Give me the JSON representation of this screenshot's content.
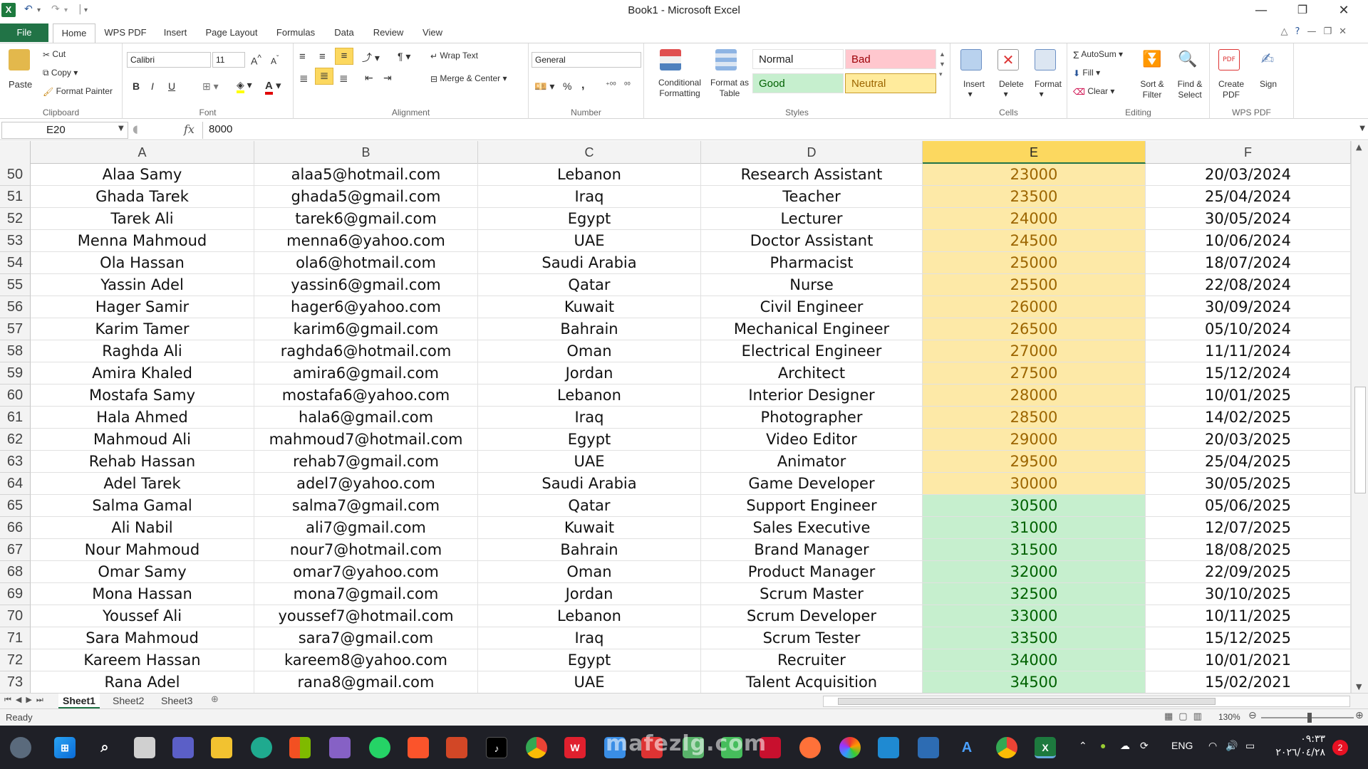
{
  "window": {
    "title": "Book1  -  Microsoft Excel",
    "controls": {
      "minimize": "—",
      "restore": "❐",
      "close": "✕"
    }
  },
  "ribbon_tabs": [
    "File",
    "Home",
    "WPS PDF",
    "Insert",
    "Page Layout",
    "Formulas",
    "Data",
    "Review",
    "View"
  ],
  "active_tab": "Home",
  "ribbon": {
    "clipboard": {
      "paste": "Paste",
      "cut": "Cut",
      "copy": "Copy",
      "format_painter": "Format Painter",
      "label": "Clipboard"
    },
    "font": {
      "name": "Calibri",
      "size": "11",
      "label": "Font",
      "bold": "B",
      "italic": "I",
      "underline": "U"
    },
    "alignment": {
      "wrap_text": "Wrap Text",
      "merge_center": "Merge & Center",
      "label": "Alignment"
    },
    "number": {
      "format": "General",
      "percent": "%",
      "comma": ",",
      "label": "Number"
    },
    "styles": {
      "conditional_formatting": "Conditional Formatting",
      "format_as_table": "Format as Table",
      "normal": "Normal",
      "bad": "Bad",
      "good": "Good",
      "neutral": "Neutral",
      "label": "Styles"
    },
    "cells": {
      "insert": "Insert",
      "delete": "Delete",
      "format": "Format",
      "label": "Cells"
    },
    "editing": {
      "autosum": "AutoSum",
      "fill": "Fill",
      "clear": "Clear",
      "sort_filter": "Sort & Filter",
      "find_select": "Find & Select",
      "label": "Editing"
    },
    "wps_pdf": {
      "create_pdf": "Create PDF",
      "sign": "Sign",
      "label": "WPS PDF"
    }
  },
  "formula_bar": {
    "name_box": "E20",
    "fx": "fx",
    "value": "8000"
  },
  "columns": [
    "A",
    "B",
    "C",
    "D",
    "E",
    "F"
  ],
  "selected_column": "E",
  "rows": [
    {
      "num": "50",
      "name": "Alaa Samy",
      "email": "alaa5@hotmail.com",
      "country": "Lebanon",
      "job": "Research Assistant",
      "salary": "23000",
      "date": "20/03/2024",
      "style": "neutral"
    },
    {
      "num": "51",
      "name": "Ghada Tarek",
      "email": "ghada5@gmail.com",
      "country": "Iraq",
      "job": "Teacher",
      "salary": "23500",
      "date": "25/04/2024",
      "style": "neutral"
    },
    {
      "num": "52",
      "name": "Tarek Ali",
      "email": "tarek6@gmail.com",
      "country": "Egypt",
      "job": "Lecturer",
      "salary": "24000",
      "date": "30/05/2024",
      "style": "neutral"
    },
    {
      "num": "53",
      "name": "Menna Mahmoud",
      "email": "menna6@yahoo.com",
      "country": "UAE",
      "job": "Doctor Assistant",
      "salary": "24500",
      "date": "10/06/2024",
      "style": "neutral"
    },
    {
      "num": "54",
      "name": "Ola Hassan",
      "email": "ola6@hotmail.com",
      "country": "Saudi Arabia",
      "job": "Pharmacist",
      "salary": "25000",
      "date": "18/07/2024",
      "style": "neutral"
    },
    {
      "num": "55",
      "name": "Yassin Adel",
      "email": "yassin6@gmail.com",
      "country": "Qatar",
      "job": "Nurse",
      "salary": "25500",
      "date": "22/08/2024",
      "style": "neutral"
    },
    {
      "num": "56",
      "name": "Hager Samir",
      "email": "hager6@yahoo.com",
      "country": "Kuwait",
      "job": "Civil Engineer",
      "salary": "26000",
      "date": "30/09/2024",
      "style": "neutral"
    },
    {
      "num": "57",
      "name": "Karim Tamer",
      "email": "karim6@gmail.com",
      "country": "Bahrain",
      "job": "Mechanical Engineer",
      "salary": "26500",
      "date": "05/10/2024",
      "style": "neutral"
    },
    {
      "num": "58",
      "name": "Raghda Ali",
      "email": "raghda6@hotmail.com",
      "country": "Oman",
      "job": "Electrical Engineer",
      "salary": "27000",
      "date": "11/11/2024",
      "style": "neutral"
    },
    {
      "num": "59",
      "name": "Amira Khaled",
      "email": "amira6@gmail.com",
      "country": "Jordan",
      "job": "Architect",
      "salary": "27500",
      "date": "15/12/2024",
      "style": "neutral"
    },
    {
      "num": "60",
      "name": "Mostafa Samy",
      "email": "mostafa6@yahoo.com",
      "country": "Lebanon",
      "job": "Interior Designer",
      "salary": "28000",
      "date": "10/01/2025",
      "style": "neutral"
    },
    {
      "num": "61",
      "name": "Hala Ahmed",
      "email": "hala6@gmail.com",
      "country": "Iraq",
      "job": "Photographer",
      "salary": "28500",
      "date": "14/02/2025",
      "style": "neutral"
    },
    {
      "num": "62",
      "name": "Mahmoud Ali",
      "email": "mahmoud7@hotmail.com",
      "country": "Egypt",
      "job": "Video Editor",
      "salary": "29000",
      "date": "20/03/2025",
      "style": "neutral"
    },
    {
      "num": "63",
      "name": "Rehab Hassan",
      "email": "rehab7@gmail.com",
      "country": "UAE",
      "job": "Animator",
      "salary": "29500",
      "date": "25/04/2025",
      "style": "neutral"
    },
    {
      "num": "64",
      "name": "Adel Tarek",
      "email": "adel7@yahoo.com",
      "country": "Saudi Arabia",
      "job": "Game Developer",
      "salary": "30000",
      "date": "30/05/2025",
      "style": "neutral"
    },
    {
      "num": "65",
      "name": "Salma Gamal",
      "email": "salma7@gmail.com",
      "country": "Qatar",
      "job": "Support Engineer",
      "salary": "30500",
      "date": "05/06/2025",
      "style": "good"
    },
    {
      "num": "66",
      "name": "Ali Nabil",
      "email": "ali7@gmail.com",
      "country": "Kuwait",
      "job": "Sales Executive",
      "salary": "31000",
      "date": "12/07/2025",
      "style": "good"
    },
    {
      "num": "67",
      "name": "Nour Mahmoud",
      "email": "nour7@hotmail.com",
      "country": "Bahrain",
      "job": "Brand Manager",
      "salary": "31500",
      "date": "18/08/2025",
      "style": "good"
    },
    {
      "num": "68",
      "name": "Omar Samy",
      "email": "omar7@yahoo.com",
      "country": "Oman",
      "job": "Product Manager",
      "salary": "32000",
      "date": "22/09/2025",
      "style": "good"
    },
    {
      "num": "69",
      "name": "Mona Hassan",
      "email": "mona7@gmail.com",
      "country": "Jordan",
      "job": "Scrum Master",
      "salary": "32500",
      "date": "30/10/2025",
      "style": "good"
    },
    {
      "num": "70",
      "name": "Youssef Ali",
      "email": "youssef7@hotmail.com",
      "country": "Lebanon",
      "job": "Scrum Developer",
      "salary": "33000",
      "date": "10/11/2025",
      "style": "good"
    },
    {
      "num": "71",
      "name": "Sara Mahmoud",
      "email": "sara7@gmail.com",
      "country": "Iraq",
      "job": "Scrum Tester",
      "salary": "33500",
      "date": "15/12/2025",
      "style": "good"
    },
    {
      "num": "72",
      "name": "Kareem Hassan",
      "email": "kareem8@yahoo.com",
      "country": "Egypt",
      "job": "Recruiter",
      "salary": "34000",
      "date": "10/01/2021",
      "style": "good"
    },
    {
      "num": "73",
      "name": "Rana Adel",
      "email": "rana8@gmail.com",
      "country": "UAE",
      "job": "Talent Acquisition",
      "salary": "34500",
      "date": "15/02/2021",
      "style": "good"
    }
  ],
  "sheets": [
    "Sheet1",
    "Sheet2",
    "Sheet3"
  ],
  "active_sheet": "Sheet1",
  "status": {
    "text": "Ready",
    "zoom": "130%"
  },
  "taskbar": {
    "language": "ENG",
    "time": "٠٩:٣٣",
    "date": "٢٠٢٦/٠٤/٢٨",
    "notifications": "2",
    "watermark": "mafezlg.com"
  }
}
